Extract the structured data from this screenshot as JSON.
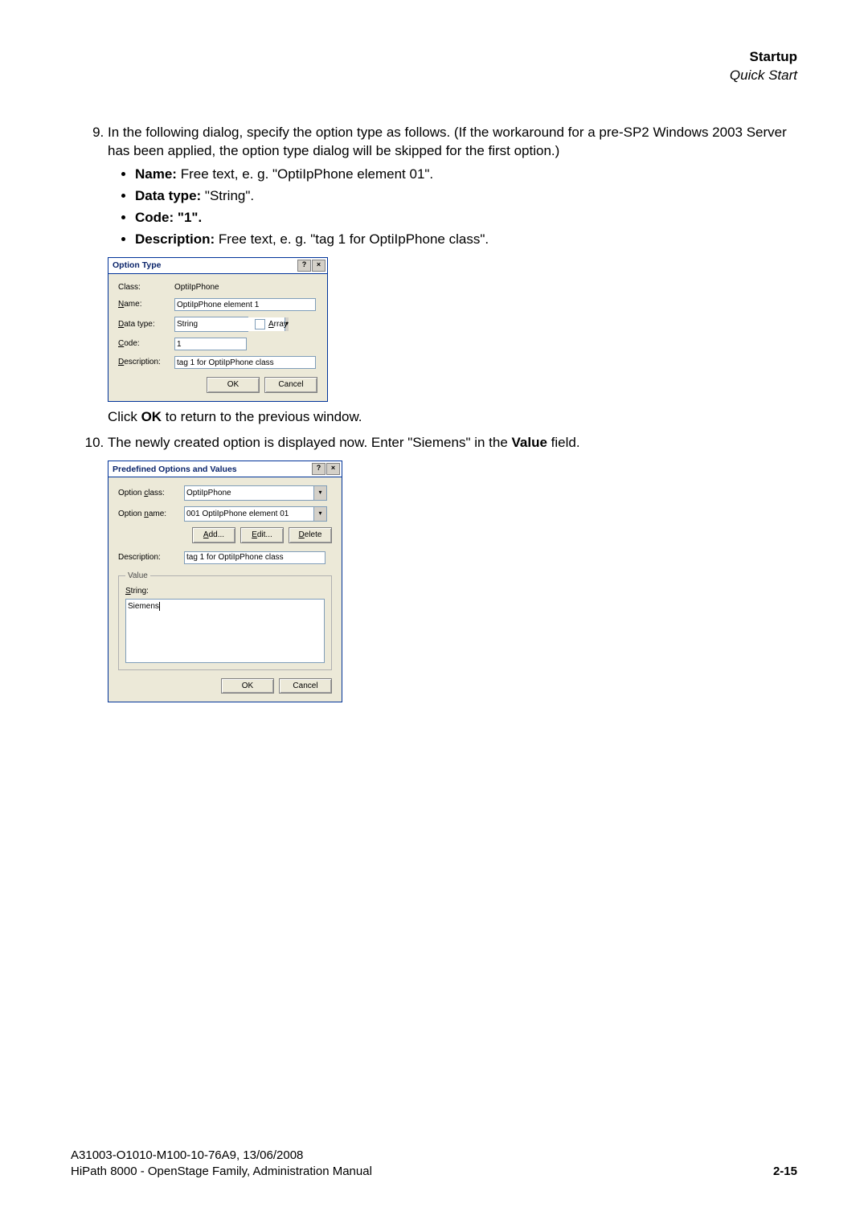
{
  "header": {
    "startup": "Startup",
    "quick": "Quick Start"
  },
  "step9": {
    "num": "9.",
    "intro": "In the following dialog, specify the option type as follows. (If the workaround for a pre-SP2 Windows 2003 Server has been applied, the option type dialog will be skipped for the first option.)",
    "bullets": {
      "name_label": "Name:",
      "name_text": " Free text, e. g. \"OptiIpPhone element 01\".",
      "datatype_label": "Data type:",
      "datatype_text": " \"String\".",
      "code_label": "Code:",
      "code_text": " \"1\".",
      "desc_label": "Description:",
      "desc_text": " Free text, e. g. \"tag 1 for OptiIpPhone class\"."
    },
    "click_pre": "Click ",
    "click_bold": "OK",
    "click_post": " to return to the previous window."
  },
  "step10": {
    "num": "10.",
    "text_pre": "The newly created option is displayed now. Enter \"Siemens\" in the ",
    "text_bold": "Value",
    "text_post": " field."
  },
  "dialog1": {
    "title": "Option Type",
    "class_label": "Class:",
    "class_value": "OptiIpPhone",
    "name_label": "Name:",
    "name_value": "OptiIpPhone element 1",
    "datatype_label": "Data type:",
    "datatype_value": "String",
    "array_label": "Array",
    "code_label": "Code:",
    "code_value": "1",
    "desc_label": "Description:",
    "desc_value": "tag 1 for OptiIpPhone class",
    "ok": "OK",
    "cancel": "Cancel"
  },
  "dialog2": {
    "title": "Predefined Options and Values",
    "class_label": "Option class:",
    "class_value": "OptiIpPhone",
    "name_label": "Option name:",
    "name_value": "001 OptiIpPhone element 01",
    "add": "Add...",
    "edit": "Edit...",
    "delete": "Delete",
    "desc_label": "Description:",
    "desc_value": "tag 1 for OptiIpPhone class",
    "value_legend": "Value",
    "string_label": "String:",
    "string_value": "Siemens",
    "ok": "OK",
    "cancel": "Cancel"
  },
  "footer": {
    "line1": "A31003-O1010-M100-10-76A9, 13/06/2008",
    "line2": "HiPath 8000 - OpenStage Family, Administration Manual",
    "page": "2-15"
  },
  "icons": {
    "help": "?",
    "close": "×",
    "down": "▾"
  }
}
